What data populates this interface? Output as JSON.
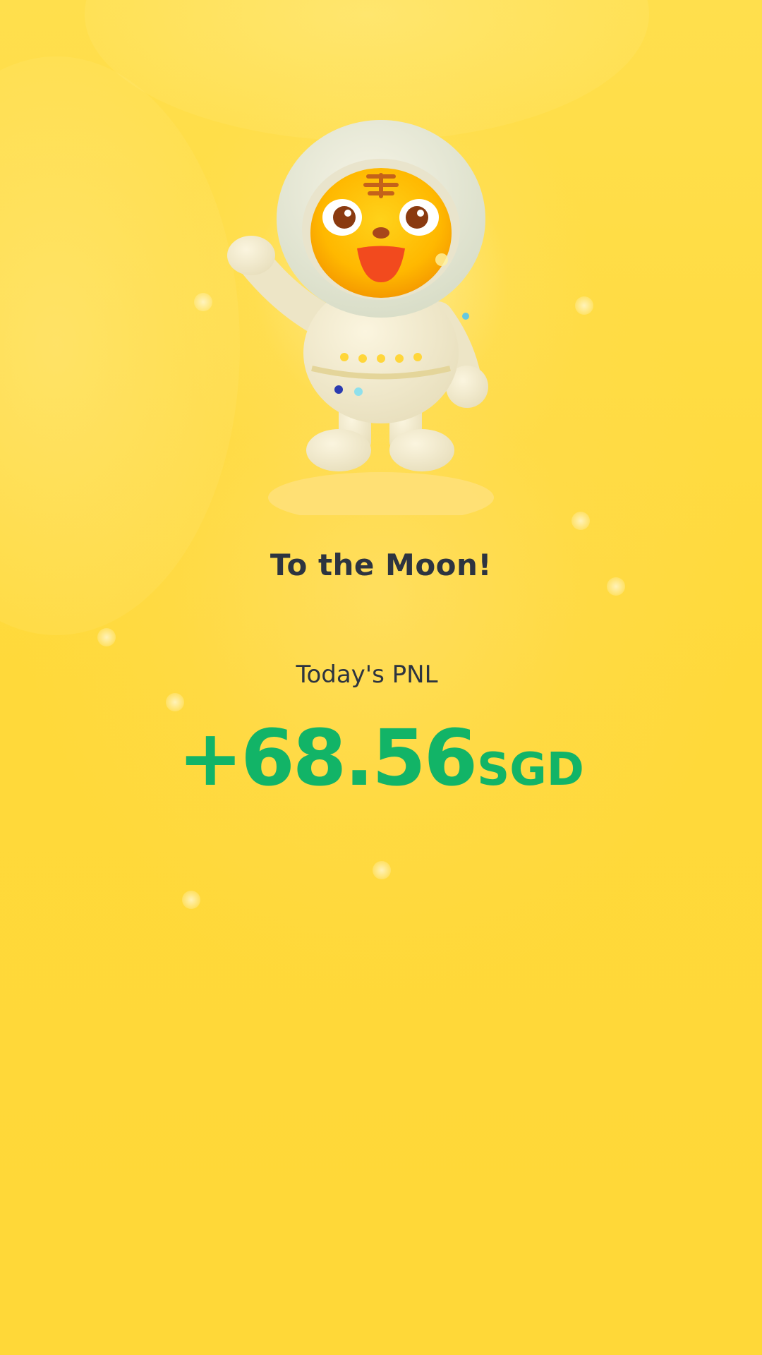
{
  "card": {
    "headline": "To the Moon!",
    "pnl_label": "Today's PNL",
    "pnl_amount": "+68.56",
    "pnl_currency": "SGD"
  },
  "mascot": {
    "icon": "astronaut-tiger-mascot"
  },
  "colors": {
    "background": "#ffd93a",
    "headline_text": "#2d3440",
    "profit_green": "#12b467"
  }
}
